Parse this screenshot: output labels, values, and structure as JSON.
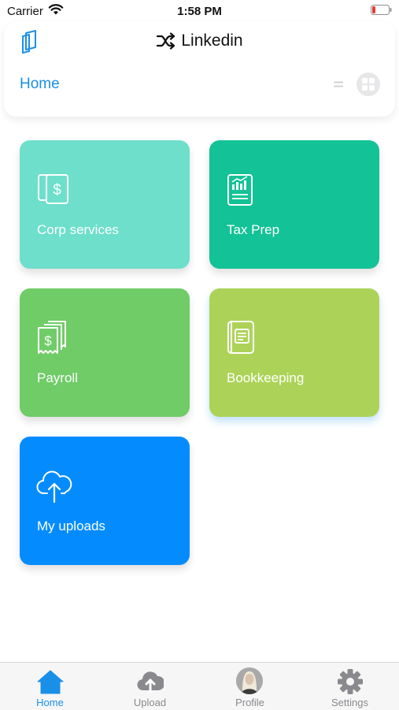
{
  "status_bar": {
    "carrier": "Carrier",
    "time": "1:58 PM"
  },
  "header": {
    "title": "Linkedin",
    "page_label": "Home"
  },
  "tiles": [
    {
      "label": "Corp services",
      "icon": "dollar-document-icon",
      "color": "#6ddfca"
    },
    {
      "label": "Tax Prep",
      "icon": "chart-report-icon",
      "color": "#13c296"
    },
    {
      "label": "Payroll",
      "icon": "receipts-icon",
      "color": "#6fcc67"
    },
    {
      "label": "Bookkeeping",
      "icon": "ledger-book-icon",
      "color": "#acd358"
    },
    {
      "label": "My uploads",
      "icon": "cloud-upload-icon",
      "color": "#048cff"
    }
  ],
  "tab_bar": [
    {
      "label": "Home",
      "icon": "home-icon",
      "active": true
    },
    {
      "label": "Upload",
      "icon": "cloud-upload-icon",
      "active": false
    },
    {
      "label": "Profile",
      "icon": "avatar",
      "active": false
    },
    {
      "label": "Settings",
      "icon": "gear-icon",
      "active": false
    }
  ],
  "colors": {
    "accent": "#1a8fe8",
    "battery_low": "#e53935"
  }
}
